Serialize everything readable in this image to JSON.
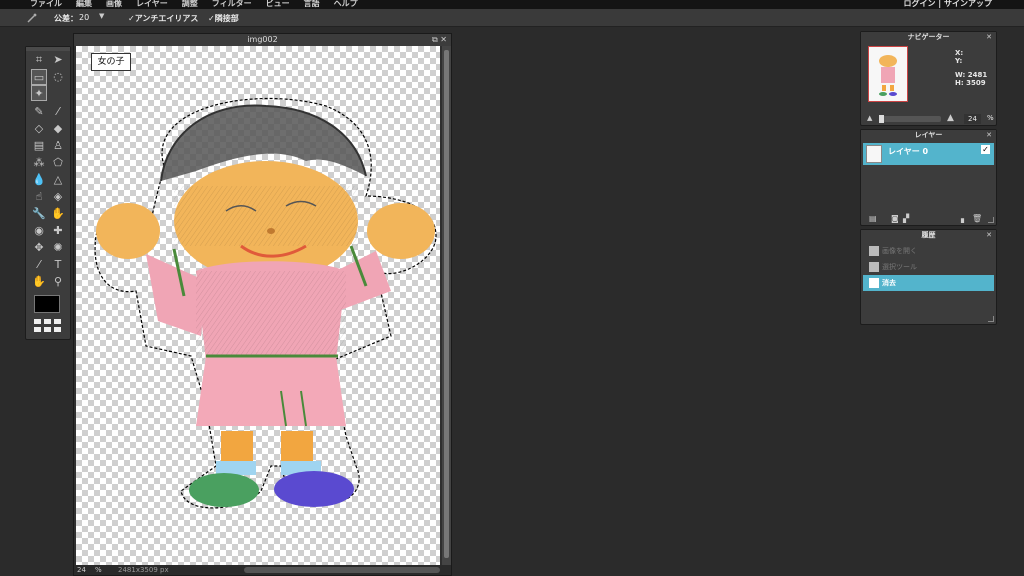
{
  "menu": {
    "items": [
      "ファイル",
      "編集",
      "画像",
      "レイヤー",
      "調整",
      "フィルター",
      "ビュー",
      "言語",
      "ヘルプ"
    ],
    "auth": "ログイン | サインアップ"
  },
  "options": {
    "tool_icon": "magic-wand-icon",
    "tolerance_label": "公差：",
    "tolerance_value": "20",
    "antialias_label": "✓アンチエイリアス",
    "contiguous_label": "✓隣接部"
  },
  "document": {
    "title": "img002",
    "caption": "女の子",
    "zoom": "24",
    "zoom_unit": "%",
    "size": "2481x3509 px"
  },
  "navigator": {
    "title": "ナビゲーター",
    "x_label": "X:",
    "y_label": "Y:",
    "w_label": "W: 2481",
    "h_label": "H: 3509",
    "zoom_value": "24",
    "zoom_unit": "%"
  },
  "layers": {
    "title": "レイヤー",
    "items": [
      {
        "label": "レイヤー 0",
        "visible": true
      }
    ]
  },
  "history": {
    "title": "履歴",
    "items": [
      {
        "label": "画像を開く",
        "selected": false
      },
      {
        "label": "選択ツール",
        "selected": false
      },
      {
        "label": "消去",
        "selected": true
      }
    ]
  },
  "colors": {
    "accent": "#53b4cc",
    "foreground": "#000000"
  }
}
